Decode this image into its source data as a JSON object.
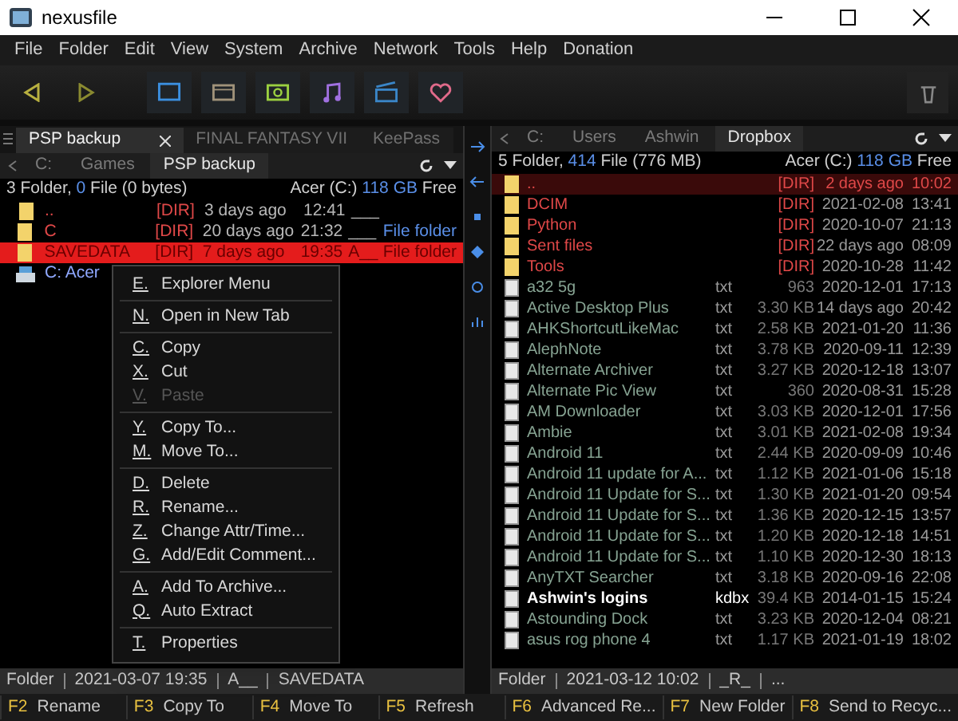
{
  "window": {
    "title": "nexusfile"
  },
  "menu": [
    "File",
    "Folder",
    "Edit",
    "View",
    "System",
    "Archive",
    "Network",
    "Tools",
    "Help",
    "Donation"
  ],
  "left_panel": {
    "active": true,
    "tabs": [
      {
        "label": "PSP backup",
        "selected": true
      },
      {
        "label": "FINAL FANTASY VII",
        "selected": false
      },
      {
        "label": "KeePass",
        "selected": false
      }
    ],
    "breadcrumb": [
      "C:",
      "Games",
      "PSP backup"
    ],
    "info": [
      {
        "text": "3",
        "hi": false
      },
      {
        "text": " Folder, ",
        "hi": false
      },
      {
        "text": "0",
        "hi": true
      },
      {
        "text": " File (0 bytes)",
        "hi": false
      }
    ],
    "free": [
      {
        "text": "Acer (C:) ",
        "hi": false
      },
      {
        "text": "118 GB",
        "hi": true
      },
      {
        "text": " Free",
        "hi": false
      }
    ],
    "rows": [
      {
        "kind": "dir",
        "name": "..",
        "tag": "[DIR]",
        "date": "3 days ago",
        "time": "12:41",
        "attr": "___",
        "type": "",
        "selected": false
      },
      {
        "kind": "dir",
        "name": "C",
        "tag": "[DIR]",
        "date": "20 days ago",
        "time": "21:32",
        "attr": "___",
        "type": "File folder",
        "selected": false
      },
      {
        "kind": "dir",
        "name": "SAVEDATA",
        "tag": "[DIR]",
        "date": "7 days ago",
        "time": "19:35",
        "attr": "A__",
        "type": "File folder",
        "selected": true
      },
      {
        "kind": "drive",
        "name": "C: Acer",
        "tag": "",
        "date": "",
        "time": "",
        "attr": "",
        "type": "",
        "selected": false
      }
    ],
    "status": [
      "Folder",
      "2021-03-07 19:35",
      "A__",
      "SAVEDATA"
    ]
  },
  "context_menu": [
    [
      {
        "key": "E.",
        "label": "Explorer Menu",
        "disabled": false
      }
    ],
    [
      {
        "key": "N.",
        "label": "Open in New Tab",
        "disabled": false
      }
    ],
    [
      {
        "key": "C.",
        "label": "Copy",
        "disabled": false
      },
      {
        "key": "X.",
        "label": "Cut",
        "disabled": false
      },
      {
        "key": "V.",
        "label": "Paste",
        "disabled": true
      }
    ],
    [
      {
        "key": "Y.",
        "label": "Copy To...",
        "disabled": false
      },
      {
        "key": "M.",
        "label": "Move To...",
        "disabled": false
      }
    ],
    [
      {
        "key": "D.",
        "label": "Delete",
        "disabled": false
      },
      {
        "key": "R.",
        "label": "Rename...",
        "disabled": false
      },
      {
        "key": "Z.",
        "label": "Change Attr/Time...",
        "disabled": false
      },
      {
        "key": "G.",
        "label": "Add/Edit Comment...",
        "disabled": false
      }
    ],
    [
      {
        "key": "A.",
        "label": "Add To Archive...",
        "disabled": false
      },
      {
        "key": "Q.",
        "label": "Auto Extract",
        "disabled": false
      }
    ],
    [
      {
        "key": "T.",
        "label": "Properties",
        "disabled": false
      }
    ]
  ],
  "right_panel": {
    "active": false,
    "breadcrumb": [
      "C:",
      "Users",
      "Ashwin",
      "Dropbox"
    ],
    "info": [
      {
        "text": "5",
        "hi": false
      },
      {
        "text": " Folder, ",
        "hi": false
      },
      {
        "text": "414",
        "hi": true
      },
      {
        "text": " File (776 MB)",
        "hi": false
      }
    ],
    "free": [
      {
        "text": "Acer (C:) ",
        "hi": false
      },
      {
        "text": "118 GB",
        "hi": true
      },
      {
        "text": " Free",
        "hi": false
      }
    ],
    "rows": [
      {
        "kind": "dir",
        "name": "..",
        "ext": "",
        "size": "[DIR]",
        "date": "2 days ago",
        "time": "10:02",
        "selected": true
      },
      {
        "kind": "dir",
        "name": "DCIM",
        "ext": "",
        "size": "[DIR]",
        "date": "2021-02-08",
        "time": "13:41",
        "selected": false
      },
      {
        "kind": "dir",
        "name": "Python",
        "ext": "",
        "size": "[DIR]",
        "date": "2020-10-07",
        "time": "21:13",
        "selected": false
      },
      {
        "kind": "dir",
        "name": "Sent files",
        "ext": "",
        "size": "[DIR]",
        "date": "22 days ago",
        "time": "08:09",
        "selected": false
      },
      {
        "kind": "dir",
        "name": "Tools",
        "ext": "",
        "size": "[DIR]",
        "date": "2020-10-28",
        "time": "11:42",
        "selected": false
      },
      {
        "kind": "file",
        "name": "a32 5g",
        "ext": "txt",
        "size": "963",
        "date": "2020-12-01",
        "time": "17:13",
        "selected": false
      },
      {
        "kind": "file",
        "name": "Active Desktop Plus",
        "ext": "txt",
        "size": "3.30 KB",
        "date": "14 days ago",
        "time": "20:42",
        "selected": false
      },
      {
        "kind": "file",
        "name": "AHKShortcutLikeMac",
        "ext": "txt",
        "size": "2.58 KB",
        "date": "2021-01-20",
        "time": "11:36",
        "selected": false
      },
      {
        "kind": "file",
        "name": "AlephNote",
        "ext": "txt",
        "size": "3.78 KB",
        "date": "2020-09-11",
        "time": "12:39",
        "selected": false
      },
      {
        "kind": "file",
        "name": "Alternate Archiver",
        "ext": "txt",
        "size": "3.27 KB",
        "date": "2020-12-18",
        "time": "13:07",
        "selected": false
      },
      {
        "kind": "file",
        "name": "Alternate Pic View",
        "ext": "txt",
        "size": "360",
        "date": "2020-08-31",
        "time": "15:28",
        "selected": false
      },
      {
        "kind": "file",
        "name": "AM Downloader",
        "ext": "txt",
        "size": "3.03 KB",
        "date": "2020-12-01",
        "time": "17:56",
        "selected": false
      },
      {
        "kind": "file",
        "name": "Ambie",
        "ext": "txt",
        "size": "3.01 KB",
        "date": "2021-02-08",
        "time": "19:34",
        "selected": false
      },
      {
        "kind": "file",
        "name": "Android 11",
        "ext": "txt",
        "size": "2.44 KB",
        "date": "2020-09-09",
        "time": "10:46",
        "selected": false
      },
      {
        "kind": "file",
        "name": "Android 11 update for A...",
        "ext": "txt",
        "size": "1.12 KB",
        "date": "2021-01-06",
        "time": "15:18",
        "selected": false
      },
      {
        "kind": "file",
        "name": "Android 11 Update for S...",
        "ext": "txt",
        "size": "1.30 KB",
        "date": "2021-01-20",
        "time": "09:54",
        "selected": false
      },
      {
        "kind": "file",
        "name": "Android 11 Update for S...",
        "ext": "txt",
        "size": "1.36 KB",
        "date": "2020-12-15",
        "time": "13:57",
        "selected": false
      },
      {
        "kind": "file",
        "name": "Android 11 Update for S...",
        "ext": "txt",
        "size": "1.20 KB",
        "date": "2020-12-18",
        "time": "14:51",
        "selected": false
      },
      {
        "kind": "file",
        "name": "Android 11 Update for S...",
        "ext": "txt",
        "size": "1.10 KB",
        "date": "2020-12-30",
        "time": "18:13",
        "selected": false
      },
      {
        "kind": "file",
        "name": "AnyTXT Searcher",
        "ext": "txt",
        "size": "3.18 KB",
        "date": "2020-09-16",
        "time": "22:08",
        "selected": false
      },
      {
        "kind": "key",
        "name": "Ashwin's logins",
        "ext": "kdbx",
        "size": "39.4 KB",
        "date": "2014-01-15",
        "time": "15:24",
        "selected": false
      },
      {
        "kind": "file",
        "name": "Astounding Dock",
        "ext": "txt",
        "size": "3.23 KB",
        "date": "2020-12-04",
        "time": "08:21",
        "selected": false
      },
      {
        "kind": "file",
        "name": "asus rog phone 4",
        "ext": "txt",
        "size": "1.17 KB",
        "date": "2021-01-19",
        "time": "18:02",
        "selected": false
      }
    ],
    "status": [
      "Folder",
      "2021-03-12 10:02",
      "_R_",
      "..."
    ]
  },
  "function_keys": [
    {
      "key": "F2",
      "label": "Rename"
    },
    {
      "key": "F3",
      "label": "Copy To"
    },
    {
      "key": "F4",
      "label": "Move To"
    },
    {
      "key": "F5",
      "label": "Refresh"
    },
    {
      "key": "F6",
      "label": "Advanced Re..."
    },
    {
      "key": "F7",
      "label": "New Folder"
    },
    {
      "key": "F8",
      "label": "Send to Recyc..."
    }
  ]
}
